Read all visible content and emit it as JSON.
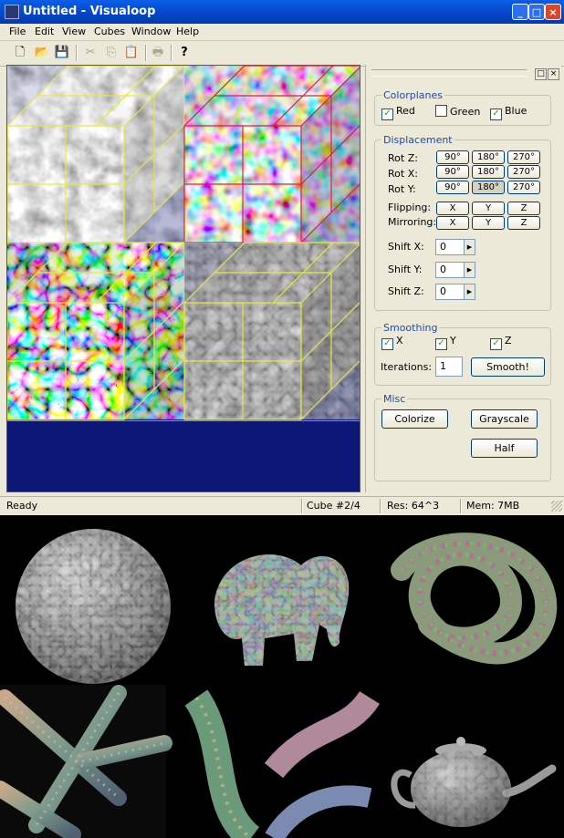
{
  "window": {
    "title": "Untitled - Visualoop"
  },
  "menu": [
    "File",
    "Edit",
    "View",
    "Cubes",
    "Window",
    "Help"
  ],
  "toolbar": {
    "icons": [
      "new-icon",
      "open-icon",
      "save-icon",
      "cut-icon",
      "copy-icon",
      "paste-icon",
      "print-icon",
      "help-icon"
    ],
    "glyphs": [
      "🗋",
      "📂",
      "💾",
      "✂",
      "⎘",
      "📋",
      "🖶",
      "?"
    ]
  },
  "panel": {
    "colorplanes": {
      "title": "Colorplanes",
      "red": "Red",
      "green": "Green",
      "blue": "Blue",
      "red_checked": true,
      "green_checked": false,
      "blue_checked": true
    },
    "displacement": {
      "title": "Displacement",
      "rot_z": "Rot Z:",
      "rot_x": "Rot X:",
      "rot_y": "Rot Y:",
      "angles": [
        "90°",
        "180°",
        "270°"
      ],
      "flipping": "Flipping:",
      "mirroring": "Mirroring:",
      "axes": [
        "X",
        "Y",
        "Z"
      ],
      "shift_x": "Shift X:",
      "shift_y": "Shift Y:",
      "shift_z": "Shift Z:",
      "shift_x_value": "0",
      "shift_y_value": "0",
      "shift_z_value": "0"
    },
    "smoothing": {
      "title": "Smoothing",
      "x": "X",
      "y": "Y",
      "z": "Z",
      "iterations_label": "Iterations:",
      "iterations_value": "1",
      "smooth_button": "Smooth!"
    },
    "misc": {
      "title": "Misc",
      "colorize": "Colorize",
      "grayscale": "Grayscale",
      "half": "Half"
    }
  },
  "status": {
    "ready": "Ready",
    "cube": "Cube #2/4",
    "res": "Res: 64^3",
    "mem": "Mem: 7MB"
  },
  "renders": [
    "sphere-render",
    "elephant-render",
    "knot-render",
    "branches-render",
    "tubes-render",
    "teapot-render"
  ]
}
